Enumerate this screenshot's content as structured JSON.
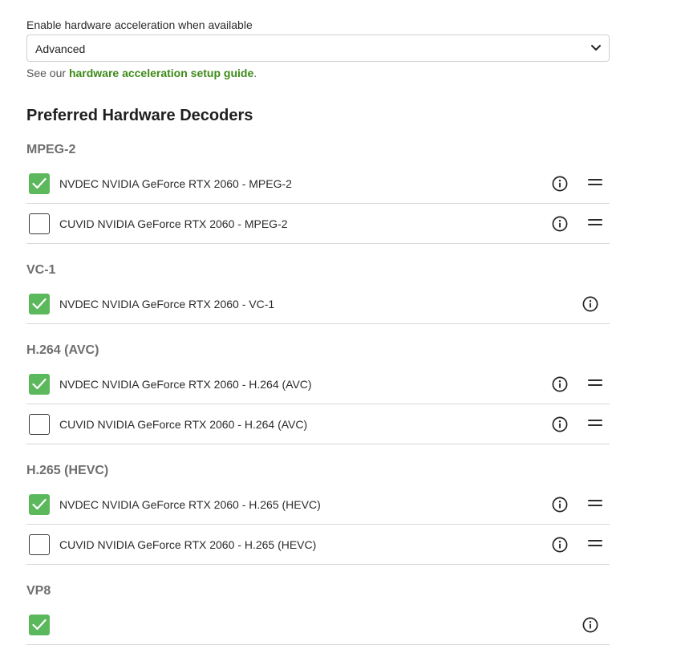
{
  "hardware_acceleration": {
    "label": "Enable hardware acceleration when available",
    "selected": "Advanced",
    "help_prefix": "See our ",
    "help_link": "hardware acceleration setup guide",
    "help_suffix": "."
  },
  "decoders": {
    "title": "Preferred Hardware Decoders",
    "groups": [
      {
        "name": "MPEG-2",
        "items": [
          {
            "label": "NVDEC NVIDIA GeForce RTX 2060 - MPEG-2",
            "checked": true
          },
          {
            "label": "CUVID NVIDIA GeForce RTX 2060 - MPEG-2",
            "checked": false
          }
        ]
      },
      {
        "name": "VC-1",
        "items": [
          {
            "label": "NVDEC NVIDIA GeForce RTX 2060 - VC-1",
            "checked": true
          }
        ]
      },
      {
        "name": "H.264 (AVC)",
        "items": [
          {
            "label": "NVDEC NVIDIA GeForce RTX 2060 - H.264 (AVC)",
            "checked": true
          },
          {
            "label": "CUVID NVIDIA GeForce RTX 2060 - H.264 (AVC)",
            "checked": false
          }
        ]
      },
      {
        "name": "H.265 (HEVC)",
        "items": [
          {
            "label": "NVDEC NVIDIA GeForce RTX 2060 - H.265 (HEVC)",
            "checked": true
          },
          {
            "label": "CUVID NVIDIA GeForce RTX 2060 - H.265 (HEVC)",
            "checked": false
          }
        ]
      },
      {
        "name": "VP8",
        "items": [
          {
            "label": "",
            "checked": true
          }
        ]
      }
    ]
  },
  "colors": {
    "accent_green": "#5cb85c",
    "link_green": "#3c8a17"
  },
  "icons": {
    "info": "info-circle-icon",
    "drag": "drag-handle-icon",
    "dropdown": "chevron-down-icon",
    "check": "checkmark-icon"
  }
}
